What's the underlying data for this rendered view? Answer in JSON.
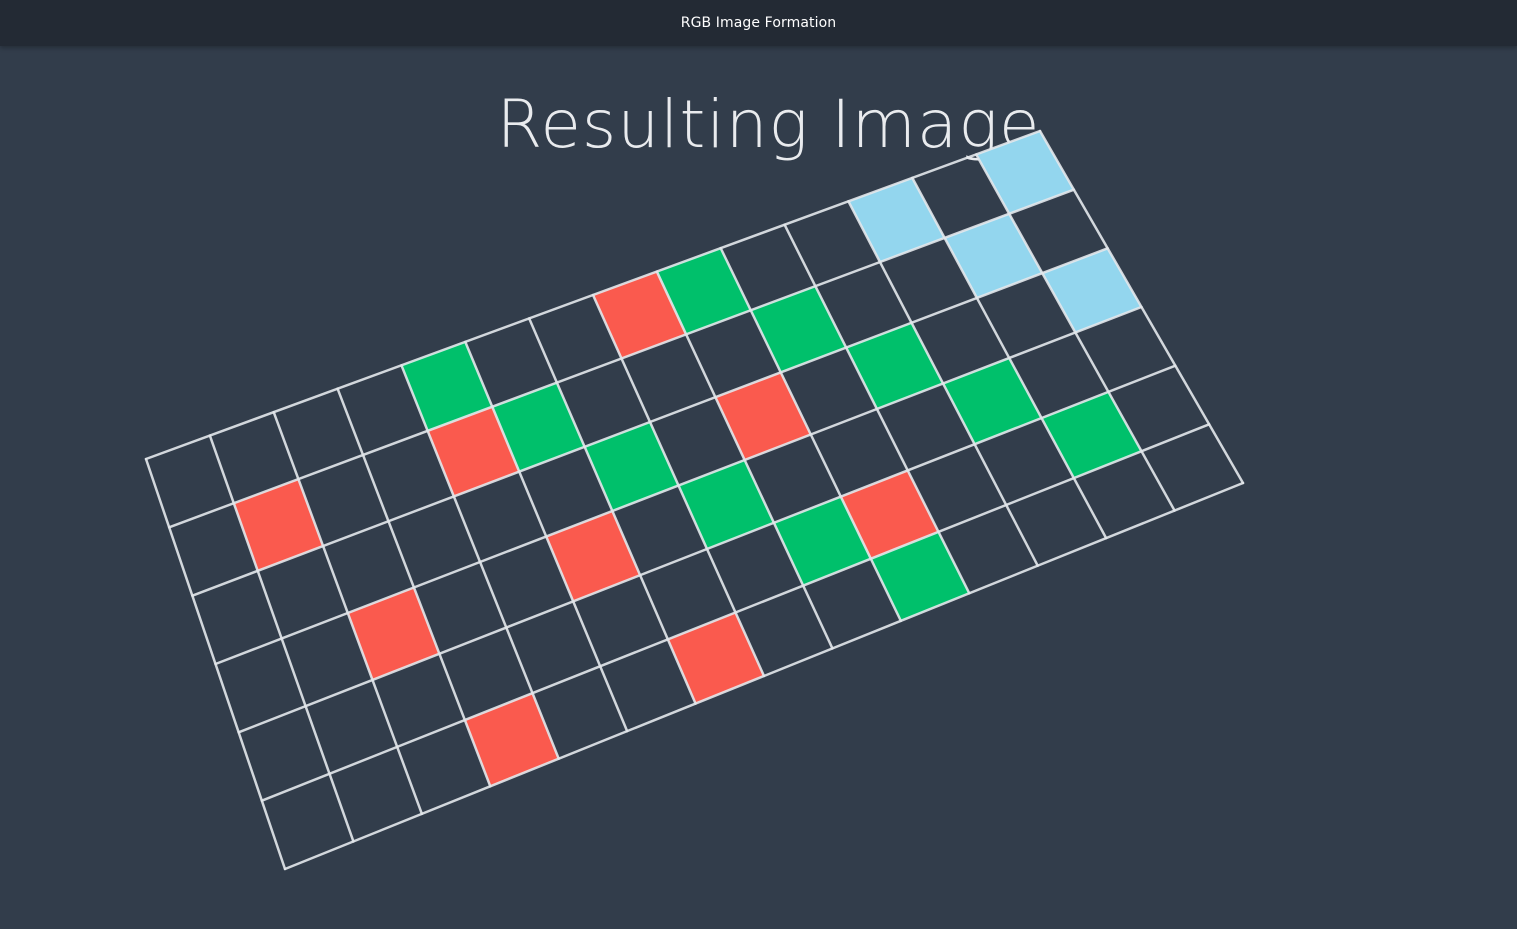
{
  "window": {
    "title": "RGB Image Formation"
  },
  "slide": {
    "heading": "Resulting Image"
  },
  "colors": {
    "background": "#323d4b",
    "titlebar": "#232a34",
    "grid_line": "#e4e8ec",
    "red": "#fa5a4e",
    "green": "#00c06b",
    "blue": "#93d6ee"
  },
  "diagram": {
    "grid": {
      "rows": 6,
      "columns": 14
    },
    "red_cells": [
      [
        1,
        1
      ],
      [
        3,
        2
      ],
      [
        5,
        3
      ],
      [
        1,
        4
      ],
      [
        3,
        5
      ],
      [
        5,
        6
      ],
      [
        0,
        7
      ],
      [
        2,
        8
      ],
      [
        4,
        9
      ]
    ],
    "green_cells": [
      [
        0,
        4
      ],
      [
        1,
        5
      ],
      [
        2,
        6
      ],
      [
        3,
        7
      ],
      [
        4,
        8
      ],
      [
        5,
        9
      ],
      [
        0,
        8
      ],
      [
        1,
        9
      ],
      [
        2,
        10
      ],
      [
        3,
        11
      ],
      [
        4,
        12
      ]
    ],
    "blue_cells": [
      [
        0,
        11
      ],
      [
        1,
        12
      ],
      [
        2,
        13
      ],
      [
        0,
        13
      ]
    ]
  }
}
